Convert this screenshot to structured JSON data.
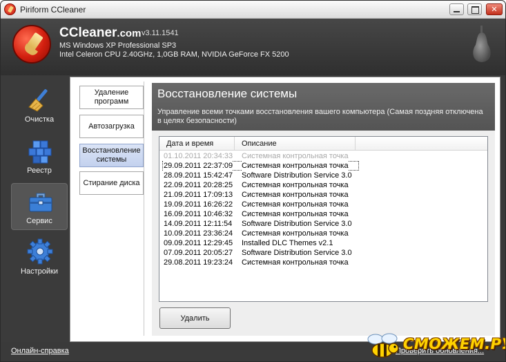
{
  "window": {
    "title": "Piriform CCleaner"
  },
  "header": {
    "brand": "CCleaner",
    "brand_tld": ".com",
    "version": "v3.11.1541",
    "os": "MS Windows XP Professional SP3",
    "hardware": "Intel Celeron CPU 2.40GHz, 1,0GB RAM, NVIDIA GeForce FX 5200"
  },
  "sidebar": {
    "items": [
      {
        "label": "Очистка",
        "icon": "broom-icon"
      },
      {
        "label": "Реестр",
        "icon": "registry-cubes-icon"
      },
      {
        "label": "Сервис",
        "icon": "toolbox-icon",
        "active": true
      },
      {
        "label": "Настройки",
        "icon": "gear-icon"
      }
    ]
  },
  "submenu": {
    "items": [
      {
        "label": "Удаление программ"
      },
      {
        "label": "Автозагрузка"
      },
      {
        "label": "Восстановление системы",
        "active": true
      },
      {
        "label": "Стирание диска"
      }
    ]
  },
  "panel": {
    "title": "Восстановление системы",
    "description": "Управление всеми точками восстановления вашего компьютера (Самая поздняя отключена в целях безопасности)"
  },
  "restore_list": {
    "columns": [
      "Дата и время",
      "Описание"
    ],
    "rows": [
      {
        "date": "01.10.2011 20:34:33",
        "desc": "Системная контрольная точка",
        "disabled": true
      },
      {
        "date": "29.09.2011 22:37:09",
        "desc": "Системная контрольная точка",
        "selected": true
      },
      {
        "date": "28.09.2011 15:42:47",
        "desc": "Software Distribution Service 3.0"
      },
      {
        "date": "22.09.2011 20:28:25",
        "desc": "Системная контрольная точка"
      },
      {
        "date": "21.09.2011 17:09:13",
        "desc": "Системная контрольная точка"
      },
      {
        "date": "19.09.2011 16:26:22",
        "desc": "Системная контрольная точка"
      },
      {
        "date": "16.09.2011 10:46:32",
        "desc": "Системная контрольная точка"
      },
      {
        "date": "14.09.2011 12:11:54",
        "desc": "Software Distribution Service 3.0"
      },
      {
        "date": "10.09.2011 23:36:24",
        "desc": "Системная контрольная точка"
      },
      {
        "date": "09.09.2011 12:29:45",
        "desc": "Installed DLC Themes v2.1"
      },
      {
        "date": "07.09.2011 20:05:27",
        "desc": "Software Distribution Service 3.0"
      },
      {
        "date": "29.08.2011 19:23:24",
        "desc": "Системная контрольная точка"
      }
    ]
  },
  "actions": {
    "delete_label": "Удалить"
  },
  "footer": {
    "help_link": "Онлайн-справка",
    "update_link": "Проверить обновления..."
  },
  "watermark": {
    "text": "СМОЖЕМ.РУ"
  },
  "colors": {
    "frame": "#3a3a3a",
    "panel_header": "#5e5e5e",
    "selected_submenu": "#c8d5ef",
    "watermark": "#ffd200"
  }
}
